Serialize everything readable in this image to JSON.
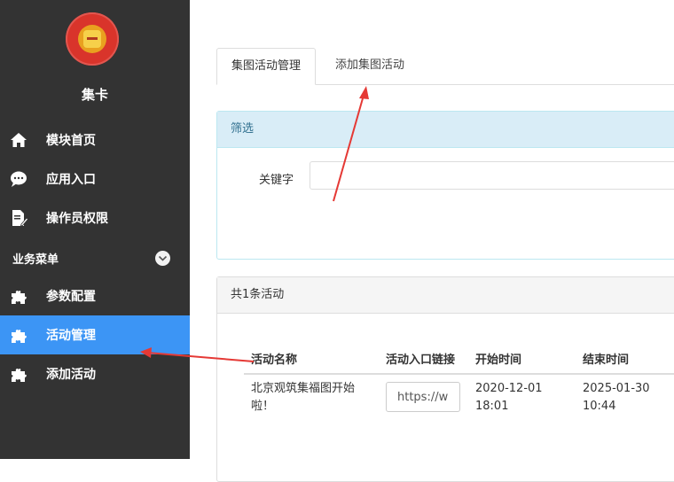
{
  "sidebar": {
    "app_name": "集卡",
    "items": [
      {
        "label": "模块首页"
      },
      {
        "label": "应用入口"
      },
      {
        "label": "操作员权限"
      }
    ],
    "section_title": "业务菜单",
    "business_items": [
      {
        "label": "参数配置"
      },
      {
        "label": "活动管理"
      },
      {
        "label": "添加活动"
      }
    ],
    "active_color": "#3c95f5"
  },
  "tabs": {
    "items": [
      {
        "label": "集图活动管理"
      },
      {
        "label": "添加集图活动"
      }
    ]
  },
  "filter": {
    "title": "筛选",
    "keyword_label": "关键字",
    "keyword_value": ""
  },
  "list": {
    "title": "共1条活动",
    "columns": [
      "活动名称",
      "活动入口链接",
      "开始时间",
      "结束时间"
    ],
    "rows": [
      {
        "name_line1": "北京观筑集福图开始",
        "name_line2": "啦！",
        "link": "https://w",
        "start_date": "2020-12-01",
        "start_time": "18:01",
        "end_date": "2025-01-30",
        "end_time": "10:44"
      }
    ]
  },
  "annotation_color": "#e53935"
}
